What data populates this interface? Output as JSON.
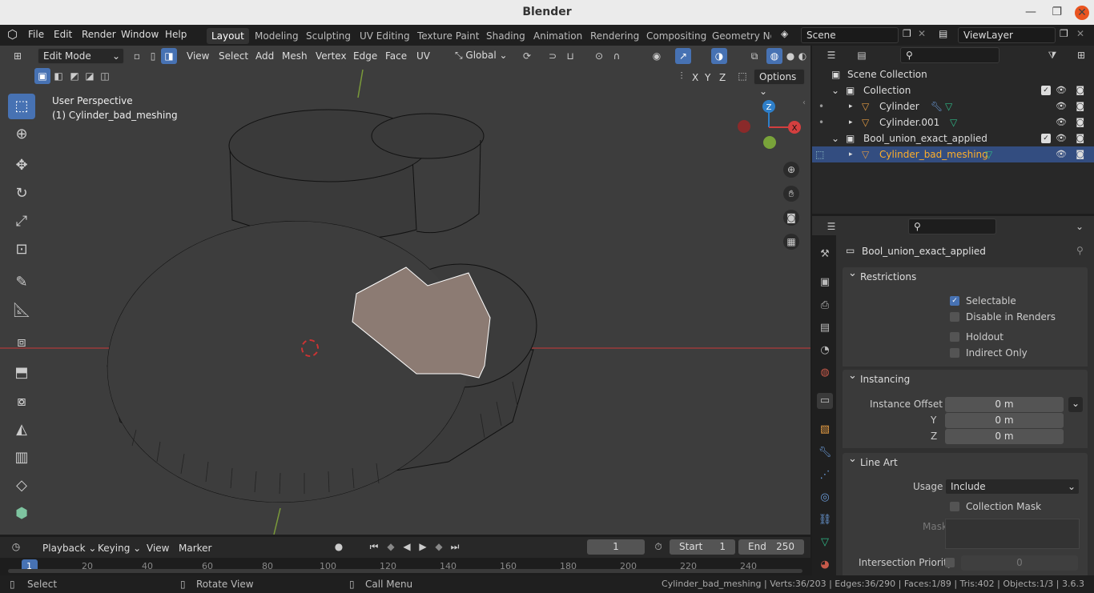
{
  "window": {
    "title": "Blender",
    "minimize": "—",
    "maximize": "❐",
    "close": "✕"
  },
  "menu": {
    "items": [
      "File",
      "Edit",
      "Render",
      "Window",
      "Help"
    ]
  },
  "workspaces": [
    "Layout",
    "Modeling",
    "Sculpting",
    "UV Editing",
    "Texture Paint",
    "Shading",
    "Animation",
    "Rendering",
    "Compositing",
    "Geometry Noc"
  ],
  "scene": {
    "name": "Scene",
    "view_layer": "ViewLayer"
  },
  "viewport_header": {
    "mode": "Edit Mode",
    "menus": [
      "View",
      "Select",
      "Add",
      "Mesh",
      "Vertex",
      "Edge",
      "Face",
      "UV"
    ],
    "transform_orientation": "Global",
    "options": "Options",
    "axes": [
      "X",
      "Y",
      "Z"
    ]
  },
  "viewport": {
    "perspective": "User Perspective",
    "object": "(1) Cylinder_bad_meshing",
    "gizmo": {
      "z": "Z",
      "x": "X"
    }
  },
  "outliner": {
    "rows": [
      {
        "label": "Scene Collection",
        "level": 0
      },
      {
        "label": "Collection",
        "level": 1
      },
      {
        "label": "Cylinder",
        "level": 2
      },
      {
        "label": "Cylinder.001",
        "level": 2
      },
      {
        "label": "Bool_union_exact_applied",
        "level": 1
      },
      {
        "label": "Cylinder_bad_meshing",
        "level": 2
      }
    ]
  },
  "properties": {
    "collection_name": "Bool_union_exact_applied",
    "restrictions": {
      "title": "Restrictions",
      "selectable": "Selectable",
      "selectable_checked": true,
      "disable_renders": "Disable in Renders",
      "holdout": "Holdout",
      "indirect_only": "Indirect Only"
    },
    "instancing": {
      "title": "Instancing",
      "offset_x_label": "Instance Offset X",
      "y_label": "Y",
      "z_label": "Z",
      "x": "0 m",
      "y": "0 m",
      "z": "0 m"
    },
    "line_art": {
      "title": "Line Art",
      "usage_label": "Usage",
      "usage": "Include",
      "collection_mask": "Collection Mask",
      "masks_label": "Masks",
      "intersection_priority": "Intersection Priority",
      "priority_value": "0"
    }
  },
  "timeline": {
    "menus": [
      "Playback",
      "Keying",
      "View",
      "Marker"
    ],
    "current_frame": "1",
    "start_label": "Start",
    "start": "1",
    "end_label": "End",
    "end": "250",
    "ticks": [
      "1",
      "20",
      "40",
      "60",
      "80",
      "100",
      "120",
      "140",
      "160",
      "180",
      "200",
      "220",
      "240"
    ]
  },
  "status": {
    "select": "Select",
    "rotate": "Rotate View",
    "call_menu": "Call Menu",
    "stats": "Cylinder_bad_meshing | Verts:36/203 | Edges:36/290 | Faces:1/89 | Tris:402 | Objects:1/3 | 3.6.3"
  },
  "colors": {
    "accent": "#4772b3",
    "selected_text": "#ffaf29",
    "face_fill": "#8c7b73",
    "x_axis": "#d33f3f",
    "z_axis": "#2e7fc9",
    "y_axis": "#79a33a"
  }
}
